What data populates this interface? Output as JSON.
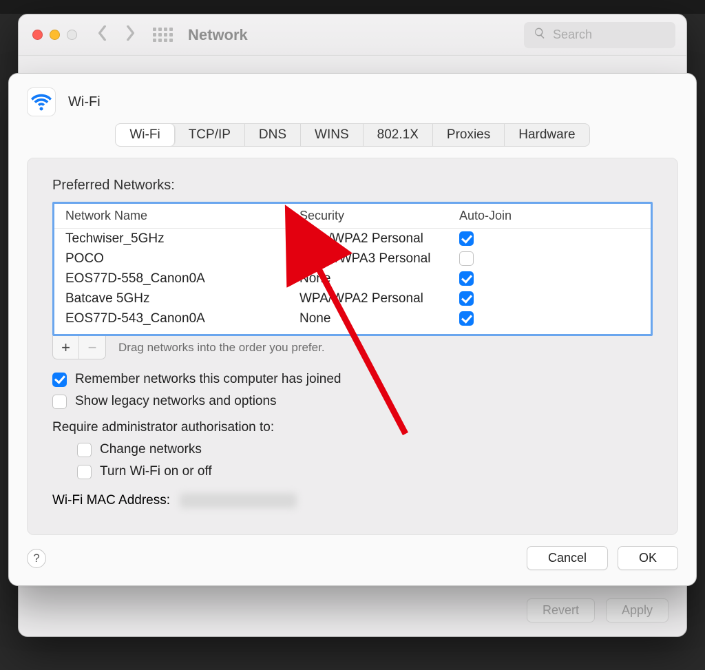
{
  "window": {
    "title": "Network",
    "search_placeholder": "Search"
  },
  "bottom": {
    "revert": "Revert",
    "apply": "Apply"
  },
  "sheet": {
    "title": "Wi-Fi",
    "tabs": [
      {
        "label": "Wi-Fi"
      },
      {
        "label": "TCP/IP"
      },
      {
        "label": "DNS"
      },
      {
        "label": "WINS"
      },
      {
        "label": "802.1X"
      },
      {
        "label": "Proxies"
      },
      {
        "label": "Hardware"
      }
    ],
    "preferred_label": "Preferred Networks:",
    "columns": {
      "name": "Network Name",
      "security": "Security",
      "join": "Auto-Join"
    },
    "rows": [
      {
        "name": "Techwiser_5GHz",
        "security": "WPA/WPA2 Personal",
        "join": true
      },
      {
        "name": "POCO",
        "security": "WPA2/WPA3 Personal",
        "join": false
      },
      {
        "name": "EOS77D-558_Canon0A",
        "security": "None",
        "join": true
      },
      {
        "name": "Batcave 5GHz",
        "security": "WPA/WPA2 Personal",
        "join": true
      },
      {
        "name": "EOS77D-543_Canon0A",
        "security": "None",
        "join": true
      }
    ],
    "drag_hint": "Drag networks into the order you prefer.",
    "remember": {
      "checked": true,
      "label": "Remember networks this computer has joined"
    },
    "legacy": {
      "checked": false,
      "label": "Show legacy networks and options"
    },
    "require_label": "Require administrator authorisation to:",
    "change_networks": {
      "checked": false,
      "label": "Change networks"
    },
    "turn_wifi": {
      "checked": false,
      "label": "Turn Wi-Fi on or off"
    },
    "mac_label": "Wi-Fi MAC Address:",
    "cancel": "Cancel",
    "ok": "OK"
  }
}
